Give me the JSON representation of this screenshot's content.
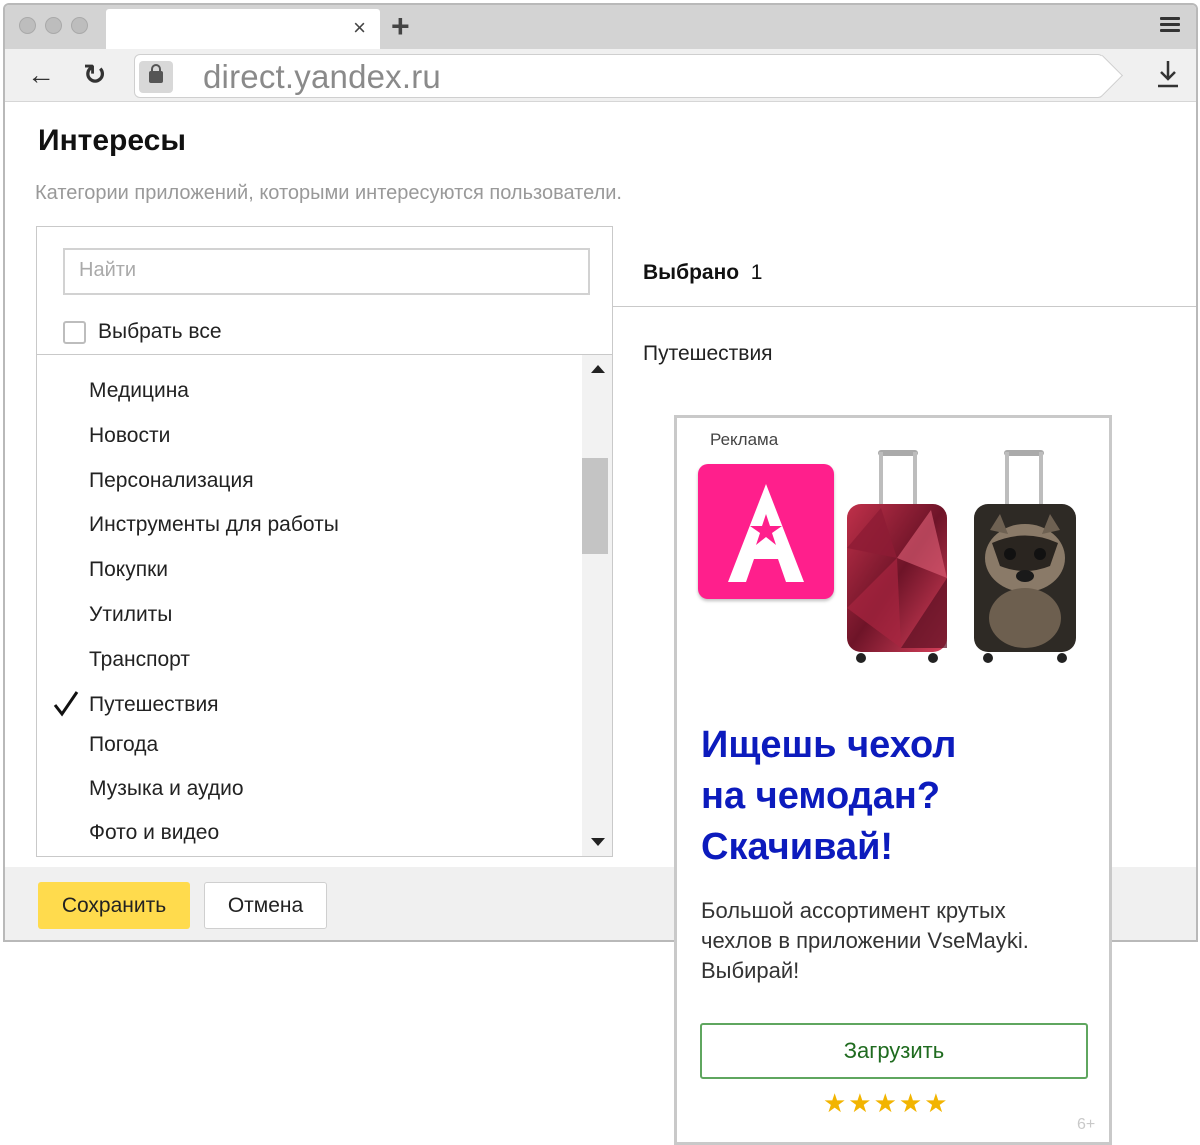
{
  "browser": {
    "tab_close": "×",
    "new_tab": "+",
    "url": "direct.yandex.ru"
  },
  "page": {
    "title": "Интересы",
    "subtitle": "Категории приложений, которыми интересуются пользователи."
  },
  "picker": {
    "search_placeholder": "Найти",
    "select_all": "Выбрать все",
    "items": [
      {
        "label": "Медицина",
        "checked": false
      },
      {
        "label": "Новости",
        "checked": false
      },
      {
        "label": "Персонализация",
        "checked": false
      },
      {
        "label": "Инструменты для работы",
        "checked": false
      },
      {
        "label": "Покупки",
        "checked": false
      },
      {
        "label": "Утилиты",
        "checked": false
      },
      {
        "label": "Транспорт",
        "checked": false
      },
      {
        "label": "Путешествия",
        "checked": true
      },
      {
        "label": "Погода",
        "checked": false
      },
      {
        "label": "Музыка и аудио",
        "checked": false
      },
      {
        "label": "Фото и видео",
        "checked": false
      }
    ]
  },
  "selected": {
    "heading": "Выбрано",
    "count": "1",
    "items": [
      "Путешествия"
    ]
  },
  "footer": {
    "save": "Сохранить",
    "cancel": "Отмена"
  },
  "ad": {
    "label": "Реклама",
    "headline": "Ищешь чехол на чемодан? Скачивай!",
    "text": "Большой ассортимент крутых чехлов в приложении VseMayki. Выбирай!",
    "button": "Загрузить",
    "rating": 4.5,
    "stars": "★★★★★",
    "age": "6+",
    "colors": {
      "icon": "#ff1f8c",
      "headline": "#0c1bbd",
      "button_border": "#5fa65f"
    }
  }
}
